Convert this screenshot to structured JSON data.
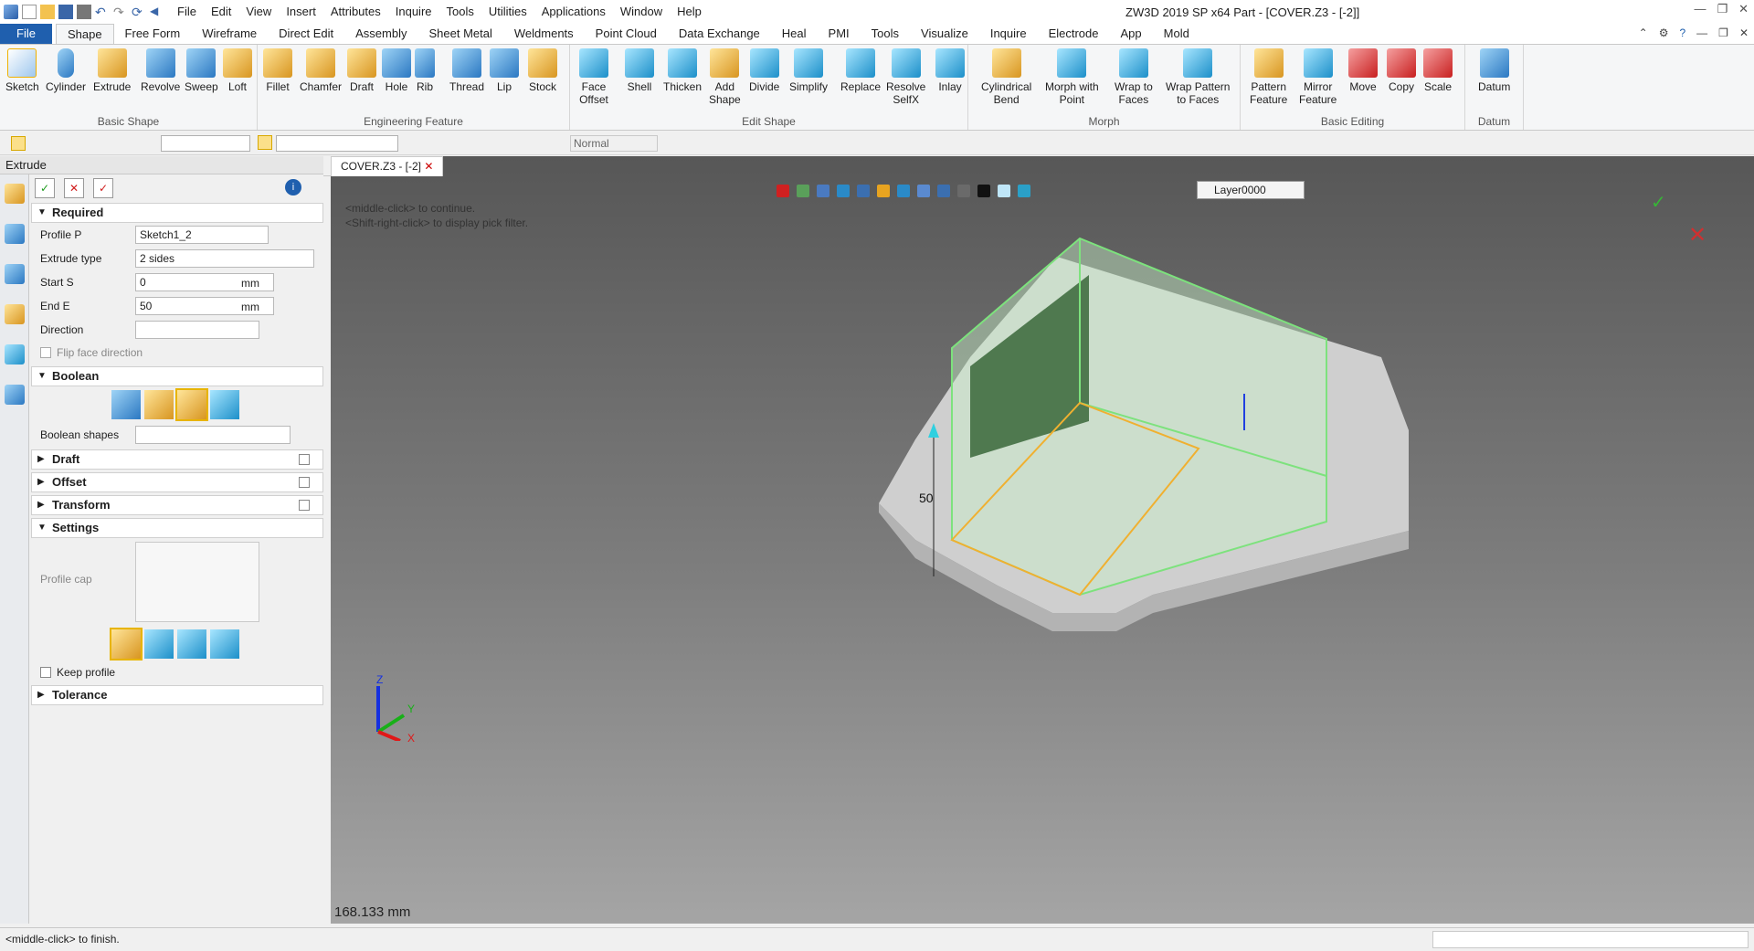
{
  "menu": [
    "File",
    "Edit",
    "View",
    "Insert",
    "Attributes",
    "Inquire",
    "Tools",
    "Utilities",
    "Applications",
    "Window",
    "Help"
  ],
  "title": "ZW3D 2019 SP x64        Part - [COVER.Z3 - [-2]]",
  "ribbon_tabs": [
    "File",
    "Shape",
    "Free Form",
    "Wireframe",
    "Direct Edit",
    "Assembly",
    "Sheet Metal",
    "Weldments",
    "Point Cloud",
    "Data Exchange",
    "Heal",
    "PMI",
    "Tools",
    "Visualize",
    "Inquire",
    "Electrode",
    "App",
    "Mold"
  ],
  "groups": {
    "basic_shape": {
      "label": "Basic Shape",
      "buttons": [
        "Sketch",
        "Cylinder",
        "Extrude",
        "Revolve",
        "Sweep",
        "Loft"
      ]
    },
    "engineering": {
      "label": "Engineering Feature",
      "buttons": [
        "Fillet",
        "Chamfer",
        "Draft",
        "Hole",
        "Rib",
        "Thread",
        "Lip",
        "Stock"
      ]
    },
    "edit_shape": {
      "label": "Edit Shape",
      "buttons": [
        "Face\nOffset",
        "Shell",
        "Thicken",
        "Add\nShape",
        "Divide",
        "Simplify",
        "Replace",
        "Resolve\nSelfX",
        "Inlay"
      ]
    },
    "morph": {
      "label": "Morph",
      "buttons": [
        "Cylindrical\nBend",
        "Morph with\nPoint",
        "Wrap to\nFaces",
        "Wrap Pattern\nto Faces"
      ]
    },
    "basic_editing": {
      "label": "Basic Editing",
      "buttons": [
        "Pattern\nFeature",
        "Mirror\nFeature",
        "Move",
        "Copy",
        "Scale"
      ]
    },
    "datum": {
      "label": "Datum",
      "buttons": [
        "Datum"
      ]
    }
  },
  "toolbar2": {
    "render_mode": "Normal"
  },
  "panel": {
    "title": "Extrude",
    "required": "Required",
    "profile_label": "Profile P",
    "profile_value": "Sketch1_2",
    "type_label": "Extrude type",
    "type_value": "2 sides",
    "start_label": "Start S",
    "start_value": "0",
    "unit": "mm",
    "end_label": "End E",
    "end_value": "50",
    "direction_label": "Direction",
    "flip_label": "Flip face direction",
    "boolean": "Boolean",
    "boolean_shapes": "Boolean shapes",
    "draft": "Draft",
    "offset": "Offset",
    "transform": "Transform",
    "settings": "Settings",
    "profile_cap": "Profile cap",
    "keep_profile": "Keep profile",
    "tolerance": "Tolerance"
  },
  "viewport": {
    "tab": "COVER.Z3 - [-2]",
    "layer": "Layer0000",
    "hint1": "<middle-click> to continue.",
    "hint2": "<Shift-right-click> to display pick filter.",
    "dim": "50",
    "measure": "168.133 mm",
    "axes": {
      "x": "X",
      "y": "Y",
      "z": "Z"
    }
  },
  "status": "<middle-click> to finish."
}
